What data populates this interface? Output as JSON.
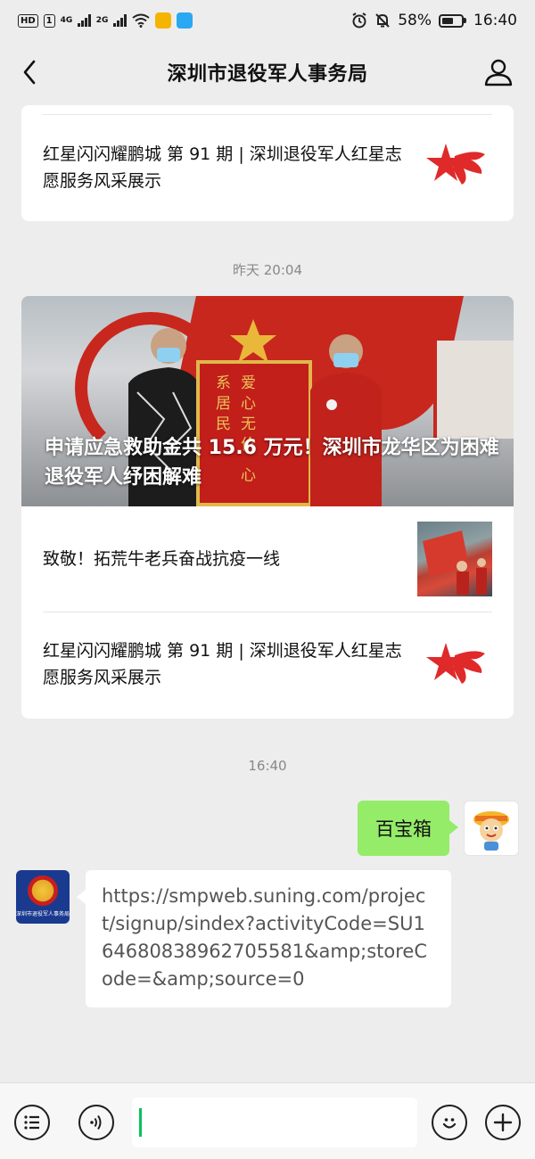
{
  "status_bar": {
    "hd_label": "HD",
    "sim_label": "1",
    "net1": "4G",
    "net2": "2G",
    "battery_percent": "58%",
    "battery_level": 0.58,
    "time": "16:40"
  },
  "nav": {
    "title": "深圳市退役军人事务局",
    "back_icon": "chevron-left-icon",
    "profile_icon": "person-icon"
  },
  "top_card": {
    "title": "红星闪闪耀鹏城 第 91 期 | 深圳退役军人红星志愿服务风采展示"
  },
  "timestamp_1": "昨天 20:04",
  "article_group": {
    "hero_title": "申请应急救助金共 15.6 万元！深圳市龙华区为困难退役军人纾困解难",
    "hero_banner_text": "爱心无价 心系居民",
    "items": [
      {
        "title": "致敬！拓荒牛老兵奋战抗疫一线"
      },
      {
        "title": "红星闪闪耀鹏城 第 91 期 | 深圳退役军人红星志愿服务风采展示"
      }
    ]
  },
  "timestamp_2": "16:40",
  "chat": {
    "sent_message": "百宝箱",
    "received_message": "https://smpweb.suning.com/project/signup/sindex?activityCode=SU164680838962705581&amp;storeCode=&amp;source=0",
    "org_avatar_label": "深圳市退役军人事务局"
  },
  "input_bar": {
    "menu_icon": "list-menu-icon",
    "voice_icon": "voice-icon",
    "emoji_icon": "emoji-icon",
    "plus_icon": "plus-icon",
    "message_value": ""
  },
  "colors": {
    "background": "#ededed",
    "sent_bubble": "#95ec69",
    "accent_green": "#07c160",
    "star_red": "#e02a2a"
  }
}
